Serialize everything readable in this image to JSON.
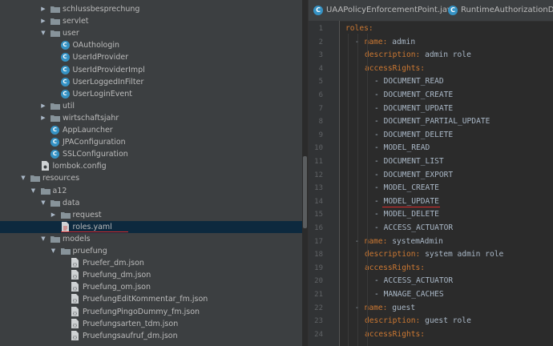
{
  "project_tree": {
    "items": [
      {
        "label": "schlussbesprechung",
        "kind": "folder",
        "depth": 2,
        "expanded": false
      },
      {
        "label": "servlet",
        "kind": "folder",
        "depth": 2,
        "expanded": false
      },
      {
        "label": "user",
        "kind": "folder",
        "depth": 2,
        "expanded": true
      },
      {
        "label": "OAuthologin",
        "kind": "class",
        "depth": 3
      },
      {
        "label": "UserIdProvider",
        "kind": "class",
        "depth": 3
      },
      {
        "label": "UserIdProviderImpl",
        "kind": "class",
        "depth": 3
      },
      {
        "label": "UserLoggedInFilter",
        "kind": "class",
        "depth": 3
      },
      {
        "label": "UserLoginEvent",
        "kind": "class",
        "depth": 3
      },
      {
        "label": "util",
        "kind": "folder",
        "depth": 2,
        "expanded": false
      },
      {
        "label": "wirtschaftsjahr",
        "kind": "folder",
        "depth": 2,
        "expanded": false
      },
      {
        "label": "AppLauncher",
        "kind": "app",
        "depth": 2
      },
      {
        "label": "JPAConfiguration",
        "kind": "class",
        "depth": 2
      },
      {
        "label": "SSLConfiguration",
        "kind": "class",
        "depth": 2
      },
      {
        "label": "lombok.config",
        "kind": "config",
        "depth": 1
      },
      {
        "label": "resources",
        "kind": "folder",
        "depth": 0,
        "expanded": true
      },
      {
        "label": "a12",
        "kind": "folder",
        "depth": 1,
        "expanded": true
      },
      {
        "label": "data",
        "kind": "folder",
        "depth": 2,
        "expanded": true
      },
      {
        "label": "request",
        "kind": "folder",
        "depth": 3,
        "expanded": false
      },
      {
        "label": "roles.yaml",
        "kind": "yaml",
        "depth": 3,
        "selected": true
      },
      {
        "label": "models",
        "kind": "folder",
        "depth": 2,
        "expanded": true
      },
      {
        "label": "pruefung",
        "kind": "folder",
        "depth": 3,
        "expanded": true
      },
      {
        "label": "Pruefer_dm.json",
        "kind": "json",
        "depth": 4
      },
      {
        "label": "Pruefung_dm.json",
        "kind": "json",
        "depth": 4
      },
      {
        "label": "Pruefung_om.json",
        "kind": "json",
        "depth": 4
      },
      {
        "label": "PruefungEditKommentar_fm.json",
        "kind": "json",
        "depth": 4
      },
      {
        "label": "PruefungPingoDummy_fm.json",
        "kind": "json",
        "depth": 4
      },
      {
        "label": "Pruefungsarten_tdm.json",
        "kind": "json",
        "depth": 4
      },
      {
        "label": "Pruefungsaufruf_dm.json",
        "kind": "json",
        "depth": 4
      }
    ]
  },
  "tabs": [
    {
      "label": "UAAPolicyEnforcementPoint.java"
    },
    {
      "label": "RuntimeAuthorizationDefini"
    }
  ],
  "code": {
    "lines": [
      {
        "n": "1",
        "indent": 0,
        "parts": [
          [
            "k",
            "roles:"
          ]
        ]
      },
      {
        "n": "2",
        "indent": 1,
        "parts": [
          [
            "d",
            "- "
          ],
          [
            "k",
            "name: "
          ],
          [
            "v",
            "admin"
          ]
        ]
      },
      {
        "n": "3",
        "indent": 2,
        "parts": [
          [
            "k",
            "description: "
          ],
          [
            "v",
            "admin role"
          ]
        ]
      },
      {
        "n": "4",
        "indent": 2,
        "parts": [
          [
            "k",
            "accessRights:"
          ]
        ]
      },
      {
        "n": "5",
        "indent": 3,
        "parts": [
          [
            "d",
            "- "
          ],
          [
            "v",
            "DOCUMENT_READ"
          ]
        ]
      },
      {
        "n": "6",
        "indent": 3,
        "parts": [
          [
            "d",
            "- "
          ],
          [
            "v",
            "DOCUMENT_CREATE"
          ]
        ]
      },
      {
        "n": "7",
        "indent": 3,
        "parts": [
          [
            "d",
            "- "
          ],
          [
            "v",
            "DOCUMENT_UPDATE"
          ]
        ]
      },
      {
        "n": "8",
        "indent": 3,
        "parts": [
          [
            "d",
            "- "
          ],
          [
            "v",
            "DOCUMENT_PARTIAL_UPDATE"
          ]
        ]
      },
      {
        "n": "9",
        "indent": 3,
        "parts": [
          [
            "d",
            "- "
          ],
          [
            "v",
            "DOCUMENT_DELETE"
          ]
        ]
      },
      {
        "n": "10",
        "indent": 3,
        "parts": [
          [
            "d",
            "- "
          ],
          [
            "v",
            "MODEL_READ"
          ]
        ]
      },
      {
        "n": "11",
        "indent": 3,
        "parts": [
          [
            "d",
            "- "
          ],
          [
            "v",
            "DOCUMENT_LIST"
          ]
        ]
      },
      {
        "n": "12",
        "indent": 3,
        "parts": [
          [
            "d",
            "- "
          ],
          [
            "v",
            "DOCUMENT_EXPORT"
          ]
        ]
      },
      {
        "n": "13",
        "indent": 3,
        "parts": [
          [
            "d",
            "- "
          ],
          [
            "v",
            "MODEL_CREATE"
          ]
        ]
      },
      {
        "n": "14",
        "indent": 3,
        "parts": [
          [
            "d",
            "- "
          ],
          [
            "v",
            "MODEL_UPDATE"
          ]
        ],
        "underline": true
      },
      {
        "n": "15",
        "indent": 3,
        "parts": [
          [
            "d",
            "- "
          ],
          [
            "v",
            "MODEL_DELETE"
          ]
        ]
      },
      {
        "n": "16",
        "indent": 3,
        "parts": [
          [
            "d",
            "- "
          ],
          [
            "v",
            "ACCESS_ACTUATOR"
          ]
        ]
      },
      {
        "n": "17",
        "indent": 1,
        "parts": [
          [
            "d",
            "- "
          ],
          [
            "k",
            "name: "
          ],
          [
            "v",
            "systemAdmin"
          ]
        ]
      },
      {
        "n": "18",
        "indent": 2,
        "parts": [
          [
            "k",
            "description: "
          ],
          [
            "v",
            "system admin role"
          ]
        ]
      },
      {
        "n": "19",
        "indent": 2,
        "parts": [
          [
            "k",
            "accessRights:"
          ]
        ]
      },
      {
        "n": "20",
        "indent": 3,
        "parts": [
          [
            "d",
            "- "
          ],
          [
            "v",
            "ACCESS_ACTUATOR"
          ]
        ]
      },
      {
        "n": "21",
        "indent": 3,
        "parts": [
          [
            "d",
            "- "
          ],
          [
            "v",
            "MANAGE_CACHES"
          ]
        ]
      },
      {
        "n": "22",
        "indent": 1,
        "parts": [
          [
            "d",
            "- "
          ],
          [
            "k",
            "name: "
          ],
          [
            "v",
            "guest"
          ]
        ]
      },
      {
        "n": "23",
        "indent": 2,
        "parts": [
          [
            "k",
            "description: "
          ],
          [
            "v",
            "guest role"
          ]
        ]
      },
      {
        "n": "24",
        "indent": 2,
        "parts": [
          [
            "k",
            "accessRights:"
          ]
        ]
      }
    ]
  },
  "colors": {
    "tree_bg": "#3c3f41",
    "editor_bg": "#2b2b2b",
    "yaml_key": "#cc7832",
    "yaml_value": "#a9b7c6",
    "selection": "#0d293e",
    "annotation_red": "#d92b2b"
  }
}
